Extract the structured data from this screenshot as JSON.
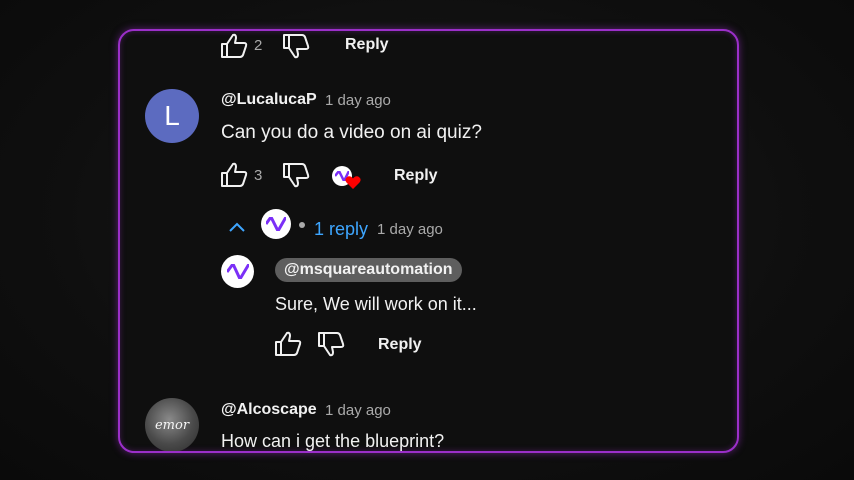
{
  "prev_comment": {
    "likes": "2",
    "reply_label": "Reply"
  },
  "comment1": {
    "avatar_letter": "L",
    "handle": "@LucalucaP",
    "time": "1 day ago",
    "text": "Can you do a video on ai quiz?",
    "likes": "3",
    "reply_label": "Reply"
  },
  "replies_toggle": {
    "label": "1 reply",
    "time": "1 day ago"
  },
  "reply1": {
    "handle": "@msquareautomation",
    "text": "Sure, We will work on it...",
    "reply_label": "Reply"
  },
  "comment2": {
    "avatar_text": "emor",
    "handle": "@Alcoscape",
    "time": "1 day ago",
    "text": "How can i get the blueprint?"
  },
  "colors": {
    "frame": "#9b2fc9",
    "avatar_l": "#5c6bc0",
    "link_blue": "#3ea6ff",
    "heart": "#ff0000",
    "channel_logo_purple": "#7b2ff7"
  },
  "icons": [
    "like-icon",
    "dislike-icon",
    "creator-heart-icon",
    "chevron-up-icon",
    "channel-logo-icon"
  ]
}
